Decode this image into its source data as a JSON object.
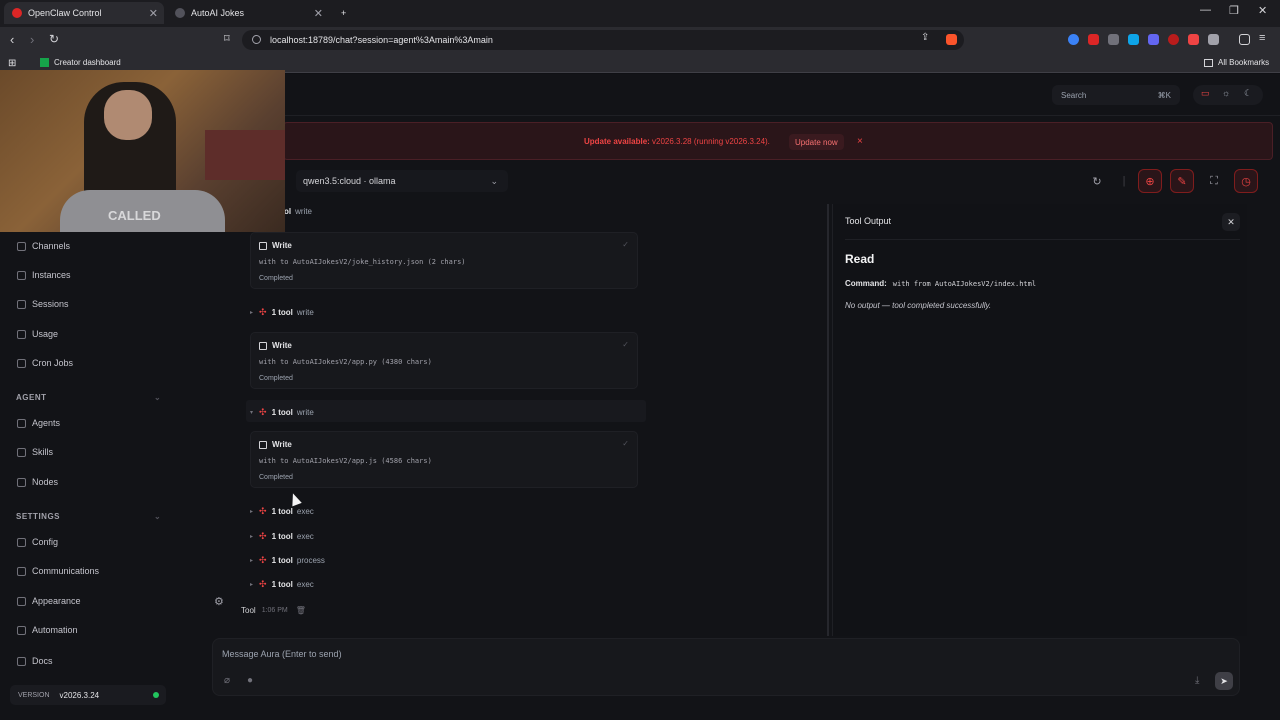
{
  "browser": {
    "tabs": [
      {
        "title": "OpenClaw Control",
        "active": true,
        "favicon_color": "#dc2626"
      },
      {
        "title": "AutoAI Jokes",
        "active": false,
        "favicon_color": "#9ca3af"
      }
    ],
    "new_tab": "+",
    "url": "localhost:18789/chat?session=agent%3Amain%3Amain",
    "bookmarks": [
      "Creator dashboard"
    ],
    "all_bookmarks": "All Bookmarks"
  },
  "top": {
    "search_placeholder": "Search",
    "search_shortcut": "⌘K"
  },
  "banner": {
    "label": "Update available:",
    "version_text": " v2026.3.28 (running v2026.3.24).",
    "button": "Update now",
    "close": "×"
  },
  "webcam": {
    "shirt_text": "CALLED"
  },
  "model": {
    "selected": "qwen3.5:cloud · ollama"
  },
  "sidebar": {
    "items_top": [
      "Channels",
      "Instances",
      "Sessions",
      "Usage",
      "Cron Jobs"
    ],
    "section_agent": "AGENT",
    "items_agent": [
      "Agents",
      "Skills",
      "Nodes"
    ],
    "section_settings": "SETTINGS",
    "items_settings": [
      "Config",
      "Communications",
      "Appearance",
      "Automation"
    ],
    "docs": "Docs",
    "version_label": "VERSION",
    "version_value": "v2026.3.24"
  },
  "chat": {
    "partial_row": {
      "count": "ol",
      "name": "write"
    },
    "cards": [
      {
        "title": "Write",
        "detail": "with to AutoAIJokesV2/joke_history.json (2 chars)",
        "status": "Completed"
      },
      {
        "title": "Write",
        "detail": "with to AutoAIJokesV2/app.py (4380 chars)",
        "status": "Completed"
      },
      {
        "title": "Write",
        "detail": "with to AutoAIJokesV2/app.js (4586 chars)",
        "status": "Completed"
      }
    ],
    "tool_rows": [
      {
        "count": "1 tool",
        "name": "write"
      },
      {
        "count": "1 tool",
        "name": "write"
      },
      {
        "count": "1 tool",
        "name": "exec"
      },
      {
        "count": "1 tool",
        "name": "exec"
      },
      {
        "count": "1 tool",
        "name": "process"
      },
      {
        "count": "1 tool",
        "name": "exec"
      }
    ],
    "footer_sender": "Tool",
    "footer_time": "1:06 PM"
  },
  "panel": {
    "header": "Tool Output",
    "title": "Read",
    "command_label": "Command:",
    "command_value": "with from AutoAIJokesV2/index.html",
    "output": "No output — tool completed successfully."
  },
  "composer": {
    "placeholder": "Message Aura (Enter to send)"
  },
  "colors": {
    "accent": "#ef4444",
    "status_ok": "#22c55e",
    "background": "#121317"
  }
}
